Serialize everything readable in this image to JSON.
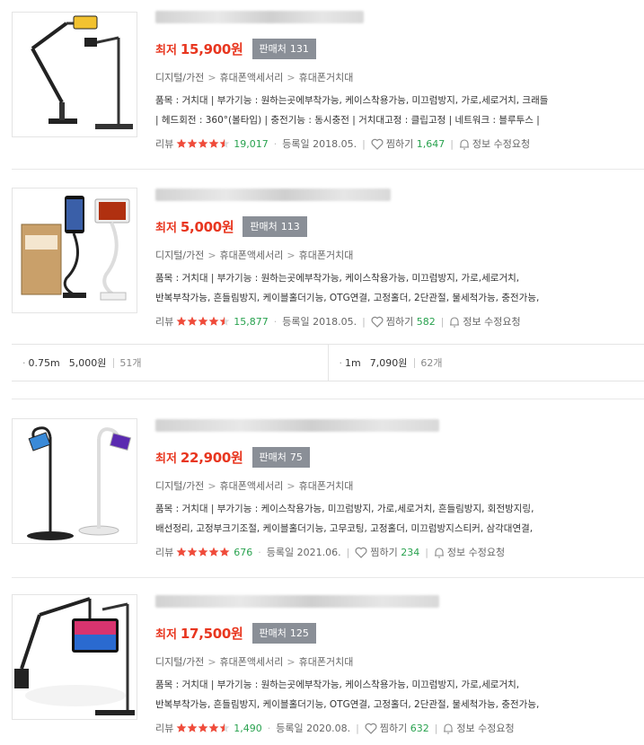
{
  "common": {
    "price_prefix": "최저",
    "sellers_label": "판매처",
    "review_label": "리뷰",
    "registered_label": "등록일",
    "wish_label": "찜하기",
    "report_label": "정보 수정요청",
    "colors": {
      "price": "#e8361f",
      "badge": "#8a8f97",
      "star": "#f04b3a",
      "count": "#29a24f"
    }
  },
  "products": [
    {
      "price": "15,900원",
      "sellers_count": "131",
      "category": [
        "디지털/가전",
        "휴대폰액세서리",
        "휴대폰거치대"
      ],
      "spec_lines": [
        "품목 : 거치대  |  부가기능 : 원하는곳에부착가능, 케이스착용가능, 미끄럼방지, 가로,세로거치, 크래들",
        "|  헤드회전 : 360°(볼타입)  |  충전기능 : 동시충전  |  거치대고정 : 클립고정  |  네트워크 : 블루투스  |"
      ],
      "rating": 4.5,
      "review_count": "19,017",
      "registered": "2018.05.",
      "wish_count": "1,647",
      "thumb_icon": "arm-stand-icon"
    },
    {
      "price": "5,000원",
      "sellers_count": "113",
      "category": [
        "디지털/가전",
        "휴대폰액세서리",
        "휴대폰거치대"
      ],
      "spec_lines": [
        "품목 : 거치대  |  부가기능 : 원하는곳에부착가능, 케이스착용가능, 미끄럼방지, 가로,세로거치,",
        "반복부착가능, 흔들림방지, 케이블홀더기능, OTG연결, 고정홀더, 2단관절, 물세척가능, 충전가능,"
      ],
      "rating": 4.5,
      "review_count": "15,877",
      "registered": "2018.05.",
      "wish_count": "582",
      "thumb_icon": "gooseneck-stand-icon"
    },
    {
      "price": "22,900원",
      "sellers_count": "75",
      "category": [
        "디지털/가전",
        "휴대폰액세서리",
        "휴대폰거치대"
      ],
      "spec_lines": [
        "품목 : 거치대  |  부가기능 : 케이스착용가능, 미끄럼방지, 가로,세로거치, 흔들림방지, 회전방지링,",
        "배선정리, 고정부크기조절, 케이블홀더기능, 고무코팅, 고정홀더, 미끄럼방지스티커, 삼각대연결,"
      ],
      "rating": 5,
      "review_count": "676",
      "registered": "2021.06.",
      "wish_count": "234",
      "thumb_icon": "floor-stand-icon"
    },
    {
      "price": "17,500원",
      "sellers_count": "125",
      "category": [
        "디지털/가전",
        "휴대폰액세서리",
        "휴대폰거치대"
      ],
      "spec_lines": [
        "품목 : 거치대  |  부가기능 : 원하는곳에부착가능, 케이스착용가능, 미끄럼방지, 가로,세로거치,",
        "반복부착가능, 흔들림방지, 케이블홀더기능, OTG연결, 고정홀더, 2단관절, 물세척가능, 충전가능,"
      ],
      "rating": 4.5,
      "review_count": "1,490",
      "registered": "2020.08.",
      "wish_count": "632",
      "thumb_icon": "tablet-arm-stand-icon"
    }
  ],
  "variants": [
    {
      "size": "0.75m",
      "price": "5,000원",
      "count": "51개"
    },
    {
      "size": "1m",
      "price": "7,090원",
      "count": "62개"
    }
  ]
}
